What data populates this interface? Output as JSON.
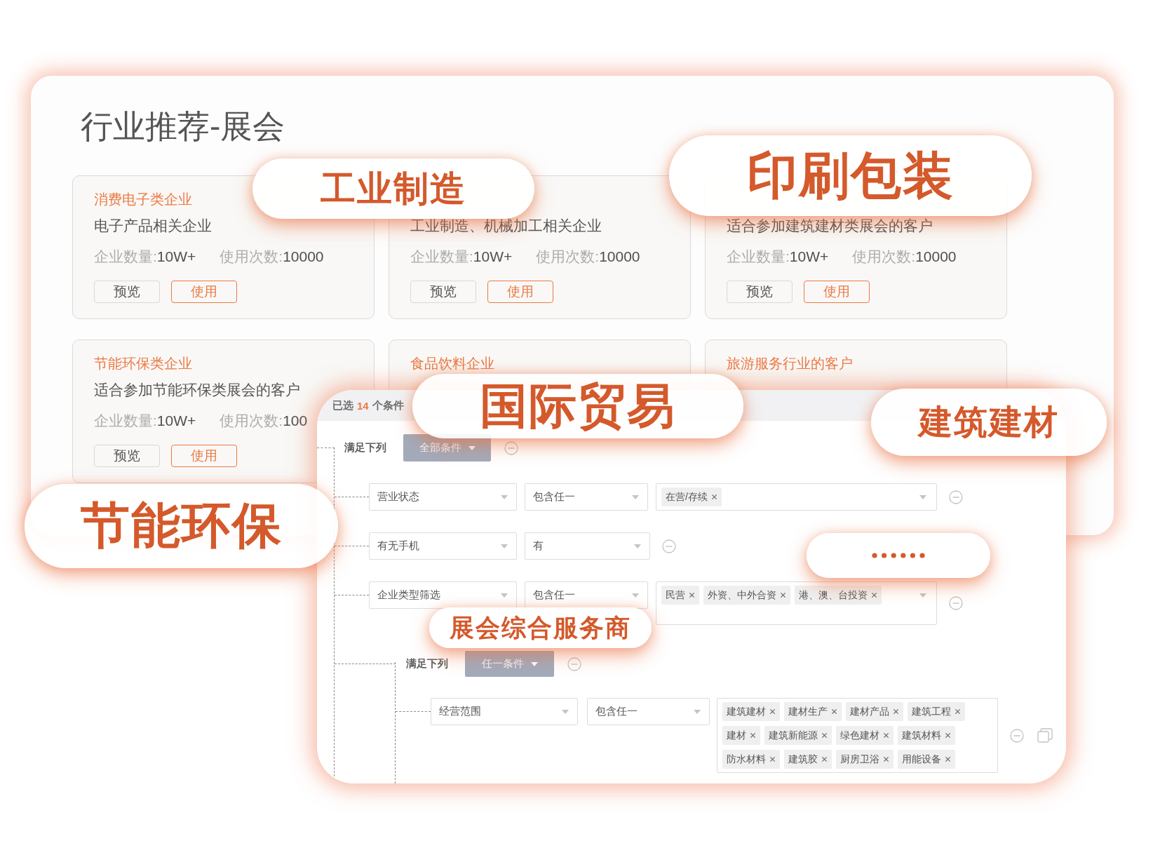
{
  "page": {
    "title": "行业推荐-展会"
  },
  "cards": [
    {
      "title": "消费电子类企业",
      "description": "电子产品相关企业",
      "stats": [
        {
          "label": "企业数量:",
          "value": "10W+"
        },
        {
          "label": "使用次数:",
          "value": "10000"
        }
      ],
      "buttons": [
        {
          "kind": "preview",
          "label": "预览"
        },
        {
          "kind": "use",
          "label": "使用"
        }
      ]
    },
    {
      "description": "工业制造、机械加工相关企业",
      "stats": [
        {
          "label": "企业数量:",
          "value": "10W+"
        },
        {
          "label": "使用次数:",
          "value": "10000"
        }
      ],
      "buttons": [
        {
          "kind": "preview",
          "label": "预览"
        },
        {
          "kind": "use",
          "label": "使用"
        }
      ]
    },
    {
      "description": "适合参加建筑建材类展会的客户",
      "stats": [
        {
          "label": "企业数量:",
          "value": "10W+"
        },
        {
          "label": "使用次数:",
          "value": "10000"
        }
      ],
      "buttons": [
        {
          "kind": "preview",
          "label": "预览"
        },
        {
          "kind": "use",
          "label": "使用"
        }
      ]
    },
    {
      "title": "节能环保类企业",
      "description": "适合参加节能环保类展会的客户",
      "stats": [
        {
          "label": "企业数量:",
          "value": "10W+"
        },
        {
          "label": "使用次数:",
          "value": "100"
        }
      ],
      "buttons": [
        {
          "kind": "preview",
          "label": "预览"
        },
        {
          "kind": "use",
          "label": "使用"
        }
      ]
    },
    {
      "title": "食品饮料企业"
    },
    {
      "title": "旅游服务行业的客户"
    }
  ],
  "filter_panel": {
    "selected": {
      "prefix": "已选",
      "count": "14",
      "suffix": "个条件"
    },
    "group": {
      "label": "满足下列",
      "mode": "全部条件",
      "conditions": [
        {
          "kind": "tags",
          "field": "营业状态",
          "operator": "包含任一",
          "tags": [
            "在营/存续"
          ]
        },
        {
          "kind": "select",
          "field": "有无手机",
          "value": "有"
        },
        {
          "kind": "tags",
          "field": "企业类型筛选",
          "operator": "包含任一",
          "tags": [
            "民营",
            "外资、中外合资",
            "港、澳、台投资"
          ]
        }
      ],
      "subgroup": {
        "label": "满足下列",
        "mode": "任一条件",
        "conditions": [
          {
            "kind": "tags",
            "field": "经营范围",
            "operator": "包含任一",
            "tags": [
              "建筑建材",
              "建材生产",
              "建材产品",
              "建筑工程",
              "建材",
              "建筑新能源",
              "绿色建材",
              "建筑材料",
              "防水材料",
              "建筑胶",
              "厨房卫浴",
              "用能设备"
            ]
          }
        ]
      }
    }
  },
  "highlights": [
    {
      "kind": "text",
      "text": "工业制造"
    },
    {
      "kind": "text",
      "text": "印刷包装"
    },
    {
      "kind": "text",
      "text": "国际贸易"
    },
    {
      "kind": "text",
      "text": "建筑建材"
    },
    {
      "kind": "text",
      "text": "节能环保"
    },
    {
      "kind": "text",
      "text": "展会综合服务商"
    },
    {
      "kind": "dots"
    }
  ]
}
